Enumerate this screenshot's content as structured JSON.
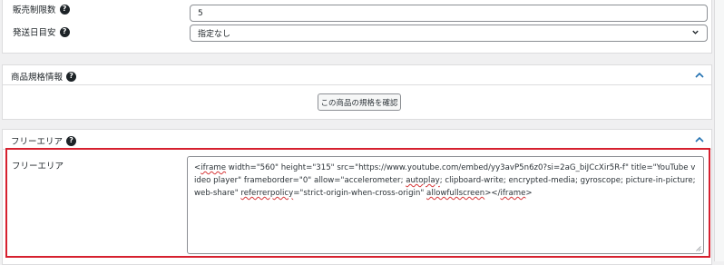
{
  "sales_limit": {
    "label": "販売制限数",
    "value": "5"
  },
  "shipping": {
    "label": "発送日目安",
    "selected": "指定なし"
  },
  "spec_section": {
    "title": "商品規格情報",
    "button_label": "この商品の規格を確認"
  },
  "free_section": {
    "title": "フリーエリア",
    "field_label": "フリーエリア",
    "textarea": {
      "p1": "<",
      "w1": "iframe",
      "p2": " width=\"560\" height=\"315\" src=\"https://www.youtube.com/embed/yy3avP5n6z0?si=2aG_biJCcXir5R-f\" title=\"YouTube video player\" frameborder=\"0\" allow=\"accelerometer; ",
      "w2": "autoplay",
      "p3": "; clipboard-write; encrypted-media; gyroscope; picture-in-picture; web-share\" ",
      "w3": "referrerpolicy",
      "p4": "=\"strict-origin-when-cross-origin\" ",
      "w4": "allowfullscreen",
      "p5": "></",
      "w5": "iframe",
      "p6": ">"
    }
  },
  "colors": {
    "highlight": "#d6202f",
    "accent": "#2271b1"
  },
  "icons": {
    "help": "question-circle-icon",
    "collapse": "chevron-up-icon",
    "dropdown": "chevron-down-icon"
  }
}
